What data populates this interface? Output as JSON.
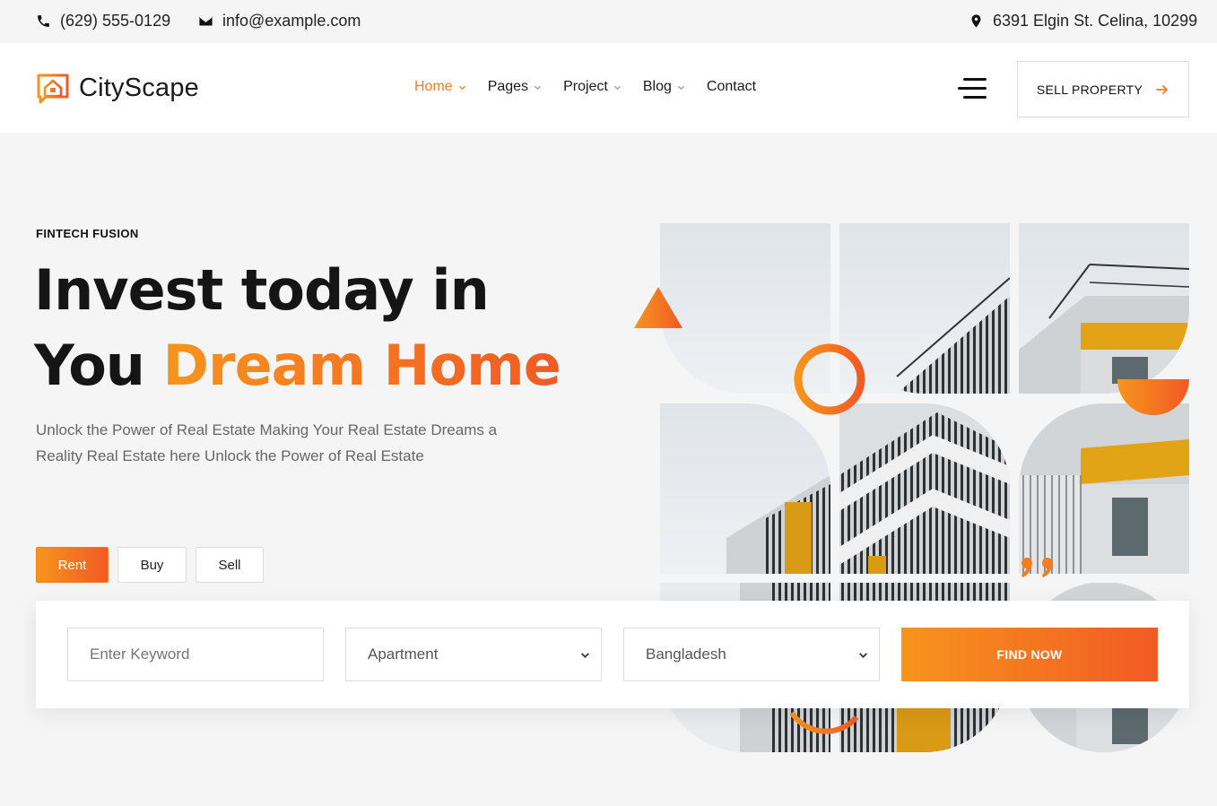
{
  "topbar": {
    "phone": "(629) 555-0129",
    "email": "info@example.com",
    "address": "6391 Elgin St. Celina, 10299"
  },
  "header": {
    "logo_text": "CityScape",
    "nav": [
      {
        "label": "Home",
        "active": true,
        "dropdown": true
      },
      {
        "label": "Pages",
        "active": false,
        "dropdown": true
      },
      {
        "label": "Project",
        "active": false,
        "dropdown": true
      },
      {
        "label": "Blog",
        "active": false,
        "dropdown": true
      },
      {
        "label": "Contact",
        "active": false,
        "dropdown": false
      }
    ],
    "cta_label": "SELL PROPERTY"
  },
  "hero": {
    "eyebrow": "FINTECH FUSION",
    "title_line1": "Invest today in",
    "title_line2_plain": "You",
    "title_line2_accent": "Dream Home",
    "description": "Unlock the Power of Real Estate Making Your Real Estate Dreams a Reality Real Estate here Unlock the Power of Real Estate"
  },
  "tabs": [
    {
      "label": "Rent",
      "active": true
    },
    {
      "label": "Buy",
      "active": false
    },
    {
      "label": "Sell",
      "active": false
    }
  ],
  "search": {
    "keyword_placeholder": "Enter Keyword",
    "type_value": "Apartment",
    "location_value": "Bangladesh",
    "submit_label": "FIND NOW"
  },
  "colors": {
    "accent_start": "#f7941d",
    "accent_end": "#f15a24",
    "text_dark": "#151515",
    "text_muted": "#666666"
  }
}
